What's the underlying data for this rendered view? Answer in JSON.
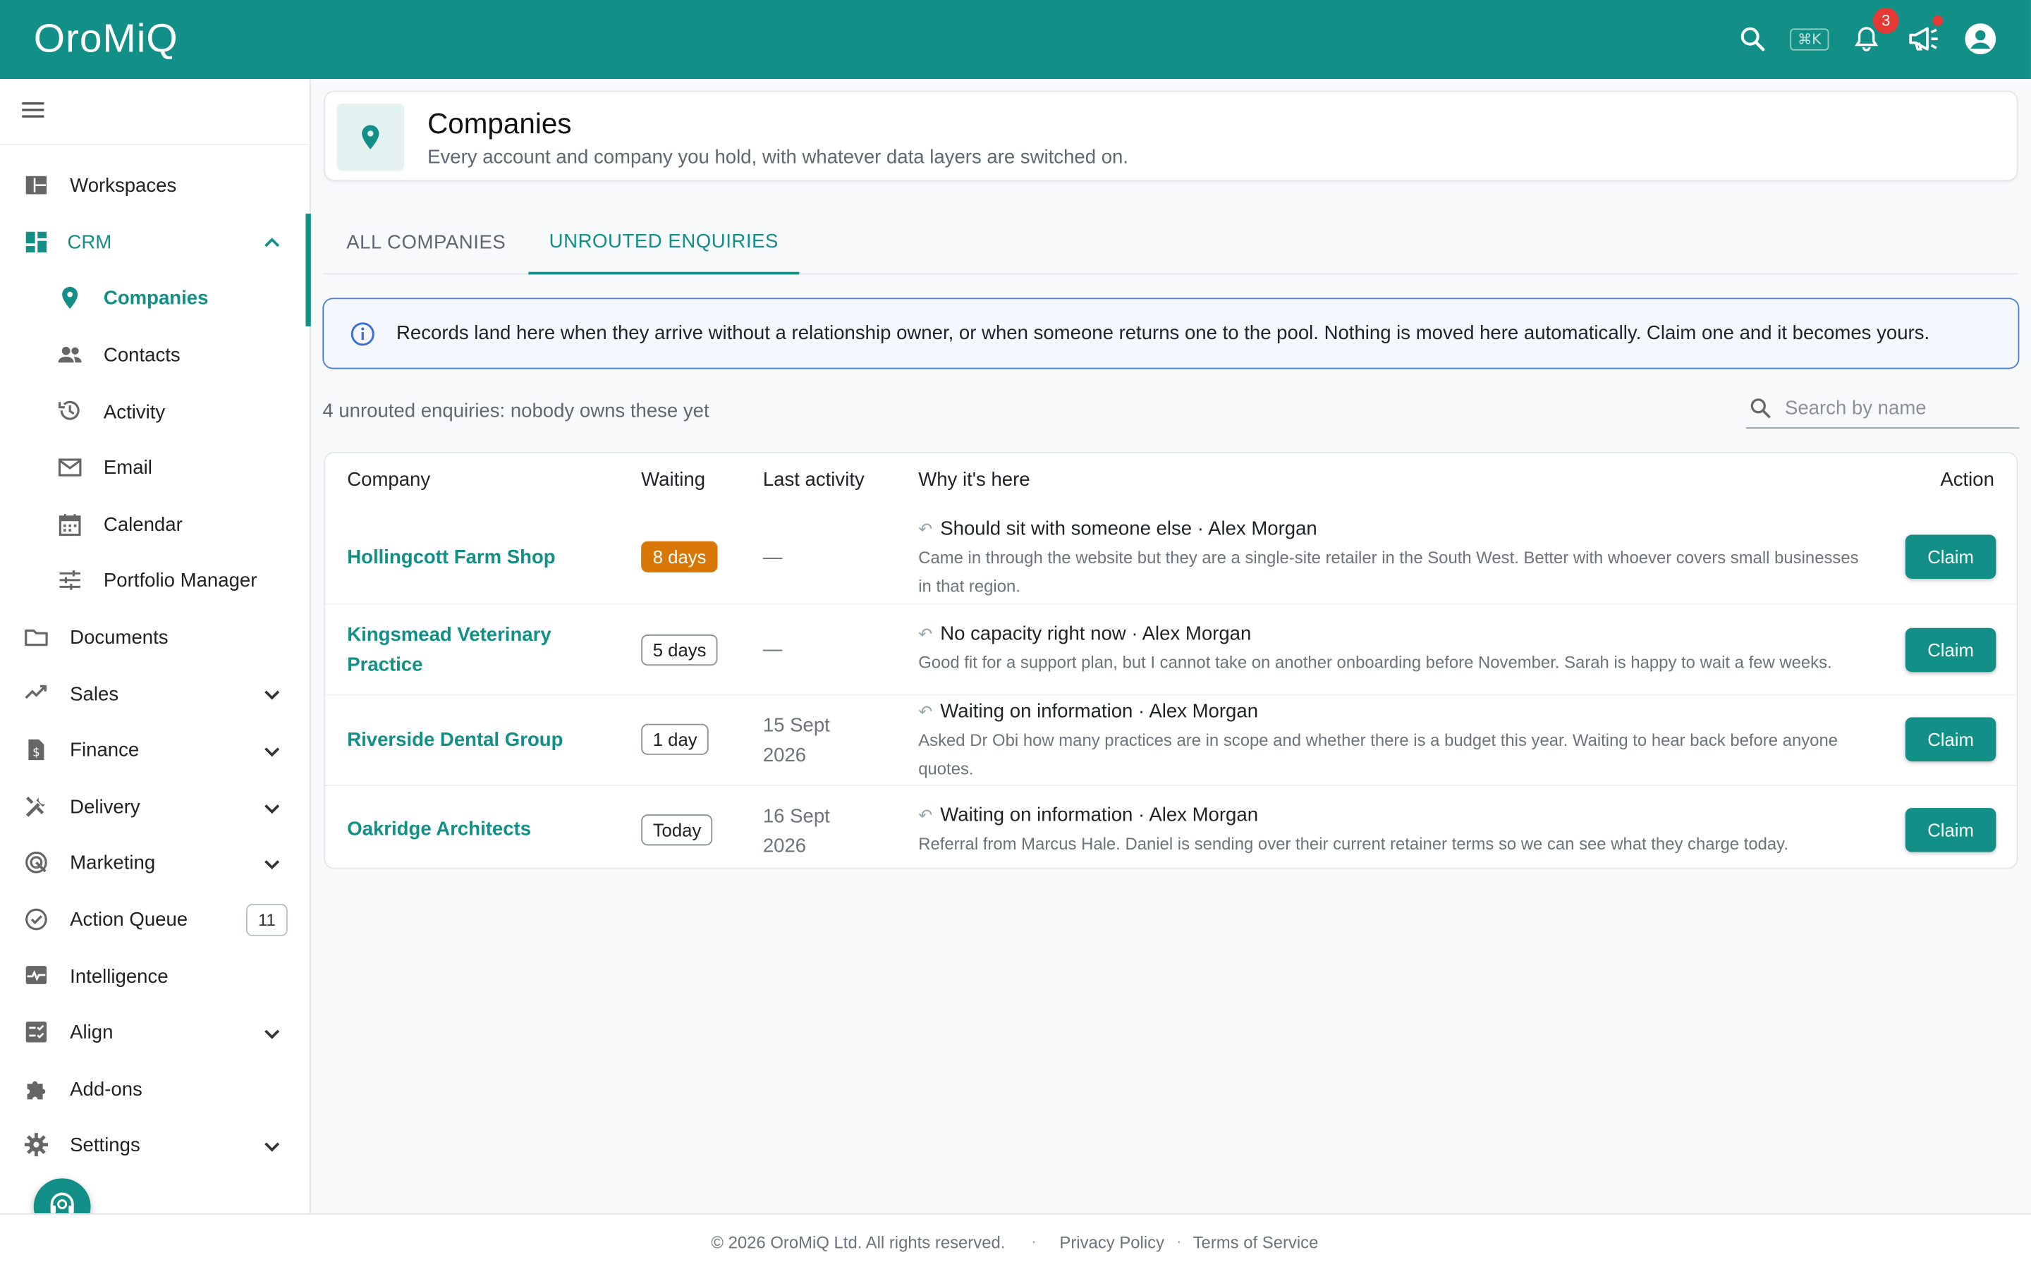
{
  "app": {
    "logo": "OroMiQ",
    "shortcut": "⌘K",
    "notifications_count": "3"
  },
  "colors": {
    "brand": "#128f86",
    "alert_border": "#4a7fd6",
    "hot_chip": "#d97706",
    "badge": "#e53935"
  },
  "sidebar": {
    "items": [
      {
        "label": "Workspaces",
        "icon": "dashboard-icon"
      },
      {
        "label": "CRM",
        "icon": "grid-icon",
        "expanded": true
      },
      {
        "label": "Companies",
        "icon": "location-pin-icon",
        "active": true
      },
      {
        "label": "Contacts",
        "icon": "people-icon"
      },
      {
        "label": "Activity",
        "icon": "history-icon"
      },
      {
        "label": "Email",
        "icon": "mail-icon"
      },
      {
        "label": "Calendar",
        "icon": "calendar-icon"
      },
      {
        "label": "Portfolio Manager",
        "icon": "sliders-icon"
      },
      {
        "label": "Documents",
        "icon": "folder-icon"
      },
      {
        "label": "Sales",
        "icon": "trending-up-icon"
      },
      {
        "label": "Finance",
        "icon": "invoice-icon"
      },
      {
        "label": "Delivery",
        "icon": "tools-icon"
      },
      {
        "label": "Marketing",
        "icon": "target-icon"
      },
      {
        "label": "Action Queue",
        "icon": "check-circle-icon",
        "count": "11"
      },
      {
        "label": "Intelligence",
        "icon": "monitor-heart-icon"
      },
      {
        "label": "Align",
        "icon": "checklist-icon"
      },
      {
        "label": "Add-ons",
        "icon": "puzzle-icon"
      },
      {
        "label": "Settings",
        "icon": "gear-icon"
      }
    ]
  },
  "header": {
    "title": "Companies",
    "subtitle": "Every account and company you hold, with whatever data layers are switched on."
  },
  "tabs": [
    {
      "label": "ALL COMPANIES",
      "active": false
    },
    {
      "label": "UNROUTED ENQUIRIES",
      "active": true
    }
  ],
  "alert": {
    "text": "Records land here when they arrive without a relationship owner, or when someone returns one to the pool. Nothing is moved here automatically. Claim one and it becomes yours."
  },
  "summary": "4 unrouted enquiries: nobody owns these yet",
  "search": {
    "placeholder": "Search by name"
  },
  "table": {
    "columns": [
      "Company",
      "Waiting",
      "Last activity",
      "Why it's here",
      "Action"
    ],
    "rows": [
      {
        "company": "Hollingcott Farm Shop",
        "waiting": "8 days",
        "waiting_overdue": true,
        "last_activity": "—",
        "reason": "Should sit with someone else",
        "person": "Alex Morgan",
        "note": "Came in through the website but they are a single-site retailer in the South West. Better with whoever covers small businesses in that region.",
        "action": "Claim"
      },
      {
        "company": "Kingsmead Veterinary Practice",
        "waiting": "5 days",
        "waiting_overdue": false,
        "last_activity": "—",
        "reason": "No capacity right now",
        "person": "Alex Morgan",
        "note": "Good fit for a support plan, but I cannot take on another onboarding before November. Sarah is happy to wait a few weeks.",
        "action": "Claim"
      },
      {
        "company": "Riverside Dental Group",
        "waiting": "1 day",
        "waiting_overdue": false,
        "last_activity": "15 Sept 2026",
        "reason": "Waiting on information",
        "person": "Alex Morgan",
        "note": "Asked Dr Obi how many practices are in scope and whether there is a budget this year. Waiting to hear back before anyone quotes.",
        "action": "Claim"
      },
      {
        "company": "Oakridge Architects",
        "waiting": "Today",
        "waiting_overdue": false,
        "last_activity": "16 Sept 2026",
        "reason": "Waiting on information",
        "person": "Alex Morgan",
        "note": "Referral from Marcus Hale. Daniel is sending over their current retainer terms so we can see what they charge today.",
        "action": "Claim"
      }
    ]
  },
  "footer": {
    "copyright": "© 2026 OroMiQ Ltd. All rights reserved.",
    "privacy": "Privacy Policy",
    "terms": "Terms of Service",
    "separator": "·"
  }
}
